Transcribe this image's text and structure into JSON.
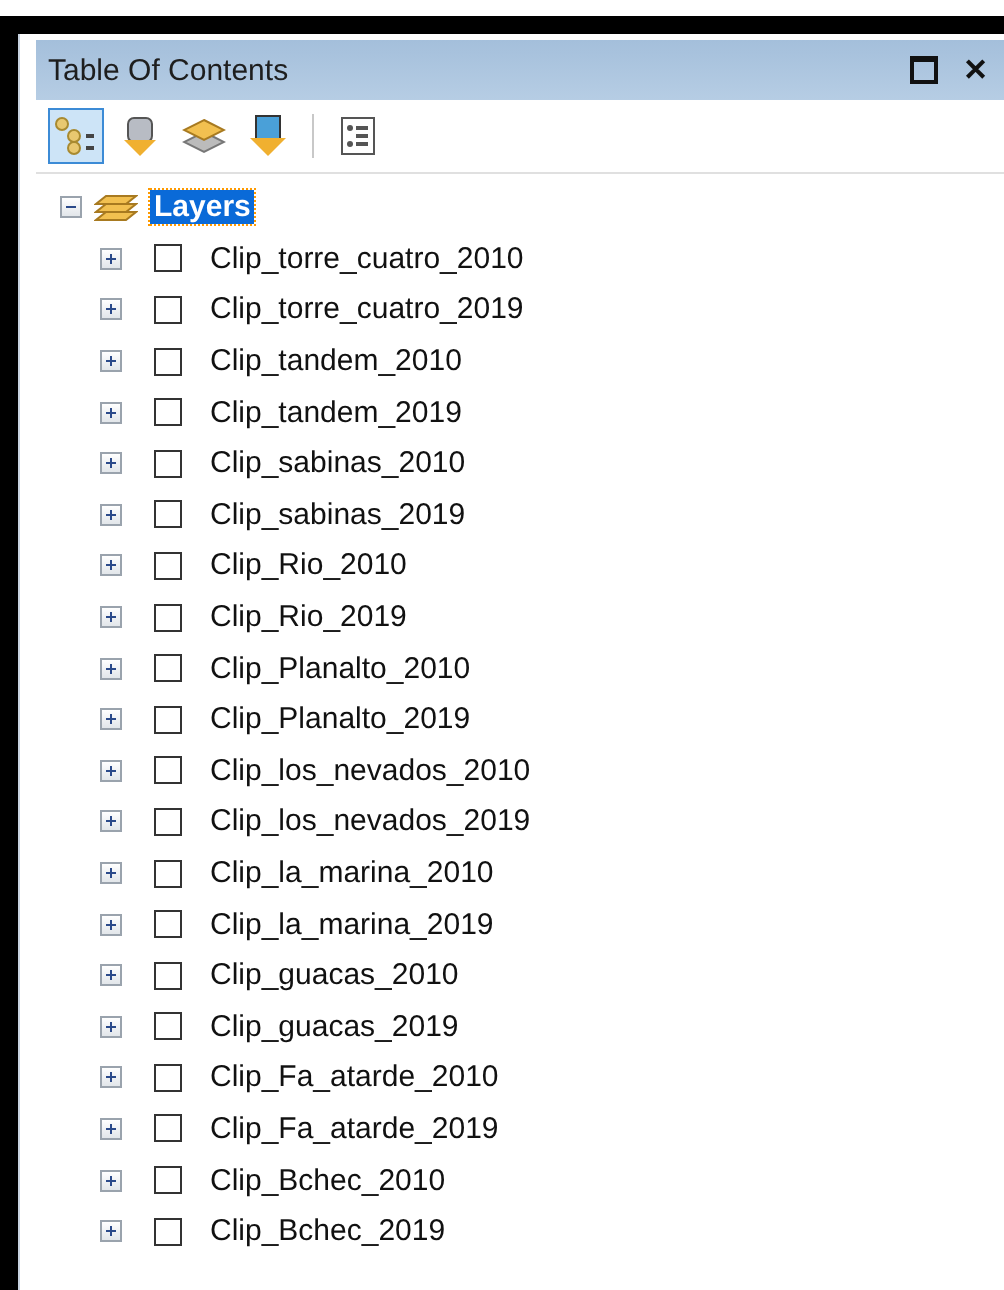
{
  "panel": {
    "title": "Table Of Contents",
    "buttons": [
      {
        "kind": "restore"
      },
      {
        "kind": "close",
        "label": "✕"
      }
    ]
  },
  "toolbar": [
    {
      "kind": "drawing-order",
      "selected": true
    },
    {
      "kind": "source",
      "selected": false
    },
    {
      "kind": "visibility",
      "selected": false
    },
    {
      "kind": "selection",
      "selected": false
    },
    {
      "kind": "options",
      "selected": false
    }
  ],
  "tree": {
    "label": "Layers",
    "expanded": true,
    "selected": true,
    "children": [
      {
        "label": "Clip_torre_cuatro_2010",
        "expanded": false,
        "checked": false
      },
      {
        "label": "Clip_torre_cuatro_2019",
        "expanded": false,
        "checked": false
      },
      {
        "label": "Clip_tandem_2010",
        "expanded": false,
        "checked": false
      },
      {
        "label": "Clip_tandem_2019",
        "expanded": false,
        "checked": false
      },
      {
        "label": "Clip_sabinas_2010",
        "expanded": false,
        "checked": false
      },
      {
        "label": "Clip_sabinas_2019",
        "expanded": false,
        "checked": false
      },
      {
        "label": "Clip_Rio_2010",
        "expanded": false,
        "checked": false
      },
      {
        "label": "Clip_Rio_2019",
        "expanded": false,
        "checked": false
      },
      {
        "label": "Clip_Planalto_2010",
        "expanded": false,
        "checked": false
      },
      {
        "label": "Clip_Planalto_2019",
        "expanded": false,
        "checked": false
      },
      {
        "label": "Clip_los_nevados_2010",
        "expanded": false,
        "checked": false
      },
      {
        "label": "Clip_los_nevados_2019",
        "expanded": false,
        "checked": false
      },
      {
        "label": "Clip_la_marina_2010",
        "expanded": false,
        "checked": false
      },
      {
        "label": "Clip_la_marina_2019",
        "expanded": false,
        "checked": false
      },
      {
        "label": "Clip_guacas_2010",
        "expanded": false,
        "checked": false
      },
      {
        "label": "Clip_guacas_2019",
        "expanded": false,
        "checked": false
      },
      {
        "label": "Clip_Fa_atarde_2010",
        "expanded": false,
        "checked": false
      },
      {
        "label": "Clip_Fa_atarde_2019",
        "expanded": false,
        "checked": false
      },
      {
        "label": "Clip_Bchec_2010",
        "expanded": false,
        "checked": false
      },
      {
        "label": "Clip_Bchec_2019",
        "expanded": false,
        "checked": false
      }
    ]
  }
}
